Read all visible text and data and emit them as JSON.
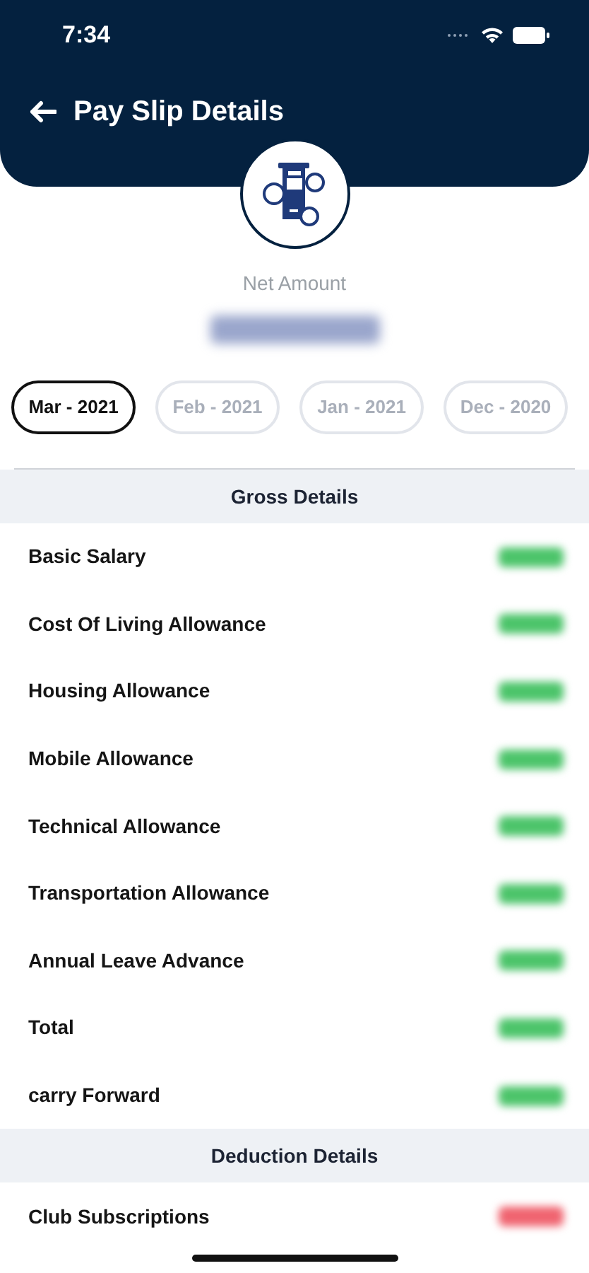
{
  "status_bar": {
    "time": "7:34"
  },
  "header": {
    "title": "Pay Slip Details"
  },
  "summary": {
    "label": "Net Amount"
  },
  "months": [
    {
      "label": "Mar - 2021",
      "selected": true
    },
    {
      "label": "Feb - 2021",
      "selected": false
    },
    {
      "label": "Jan - 2021",
      "selected": false
    },
    {
      "label": "Dec - 2020",
      "selected": false
    }
  ],
  "sections": [
    {
      "title": "Gross Details",
      "color": "#4cc46a",
      "rows": [
        {
          "label": "Basic Salary"
        },
        {
          "label": "Cost Of Living Allowance"
        },
        {
          "label": "Housing Allowance"
        },
        {
          "label": "Mobile Allowance"
        },
        {
          "label": "Technical Allowance"
        },
        {
          "label": "Transportation Allowance"
        },
        {
          "label": "Annual Leave Advance"
        },
        {
          "label": "Total"
        },
        {
          "label": "carry Forward"
        }
      ]
    },
    {
      "title": "Deduction Details",
      "color": "#f06470",
      "rows": [
        {
          "label": "Club Subscriptions"
        }
      ]
    }
  ]
}
